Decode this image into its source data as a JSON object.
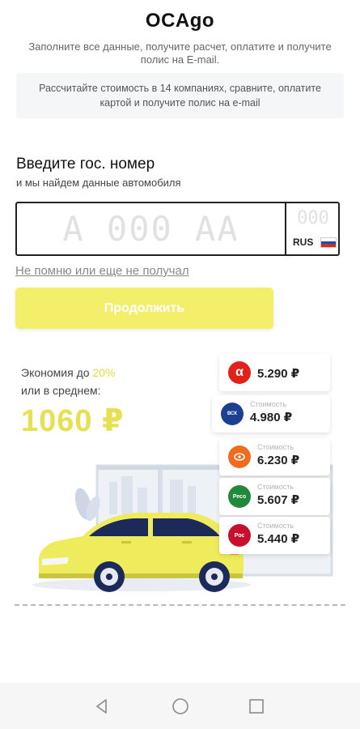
{
  "header": {
    "title": "OCAgo",
    "subtitle": "Заполните все данные, получите расчет, оплатите и получите полис на E-mail."
  },
  "banner": {
    "text": "Рассчитайте стоимость в 14 компаниях, сравните, оплатите картой и получите полис на e-mail"
  },
  "plate_form": {
    "heading": "Введите гос. номер",
    "subheading": "и мы найдем данные автомобиля",
    "number_placeholder": "А 000 АА",
    "region_placeholder": "000",
    "country": "RUS",
    "forgot_link": "Не помню или еще не получал",
    "continue_button": "Продолжить"
  },
  "savings": {
    "prefix": "Экономия до ",
    "percent": "20%",
    "line2": "или в среднем:",
    "amount": "1060 ₽"
  },
  "quotes": [
    {
      "logo": "alfa-logo",
      "caption": "",
      "price": "5.290 ₽",
      "color": "#e0221b"
    },
    {
      "logo": "vsk-logo",
      "caption": "Стоимость",
      "price": "4.980 ₽",
      "color": "#1c3f8f"
    },
    {
      "logo": "ingos-logo",
      "caption": "Стоимость",
      "price": "6.230 ₽",
      "color": "#f26b1d"
    },
    {
      "logo": "reso-logo",
      "caption": "Стоимость",
      "price": "5.607 ₽",
      "color": "#1f8b3a"
    },
    {
      "logo": "rosgosstrakh-logo",
      "caption": "Стоимость",
      "price": "5.440 ₽",
      "color": "#c8102e"
    }
  ],
  "colors": {
    "accent_yellow": "#f3ef6a",
    "savings_yellow": "#e6e152",
    "car_body": "#eeeb5c"
  },
  "nav": {
    "icons": [
      "back-icon",
      "home-icon",
      "recents-icon"
    ]
  }
}
